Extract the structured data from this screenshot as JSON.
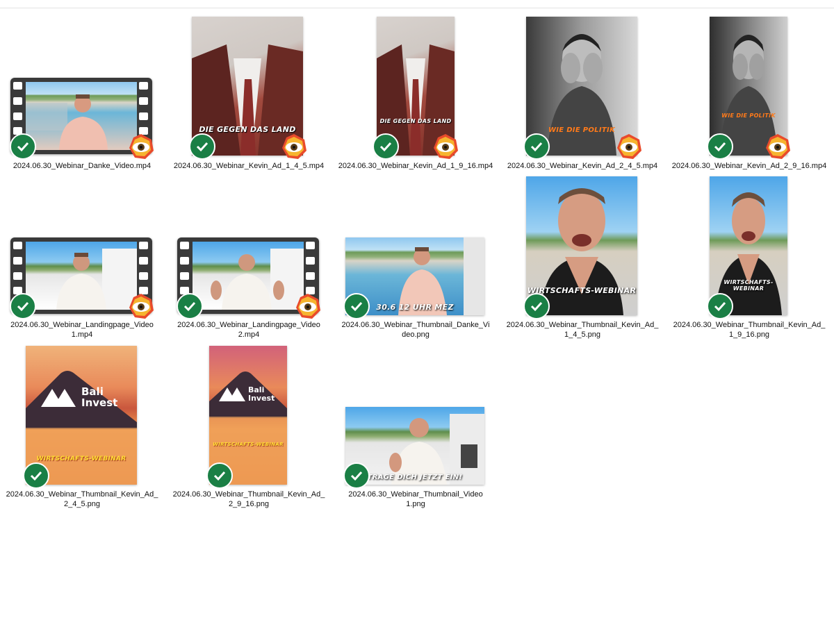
{
  "files": [
    {
      "name": "2024.06.30_Webinar_Danke_Video.mp4",
      "kind": "video",
      "overlay_text": ""
    },
    {
      "name": "2024.06.30_Webinar_Kevin_Ad_1_4_5.mp4",
      "kind": "video",
      "overlay_text": "DIE GEGEN DAS LAND"
    },
    {
      "name": "2024.06.30_Webinar_Kevin_Ad_1_9_16.mp4",
      "kind": "video",
      "overlay_text": "DIE GEGEN DAS LAND"
    },
    {
      "name": "2024.06.30_Webinar_Kevin_Ad_2_4_5.mp4",
      "kind": "video",
      "overlay_text": "WIE DIE POLITIK"
    },
    {
      "name": "2024.06.30_Webinar_Kevin_Ad_2_9_16.mp4",
      "kind": "video",
      "overlay_text": "WIE DIE POLITIK"
    },
    {
      "name": "2024.06.30_Webinar_Landingpage_Video\n1.mp4",
      "kind": "video",
      "overlay_text": ""
    },
    {
      "name": "2024.06.30_Webinar_Landingpage_Video\n2.mp4",
      "kind": "video",
      "overlay_text": ""
    },
    {
      "name": "2024.06.30_Webinar_Thumbnail_Danke_Vi\ndeo.png",
      "kind": "image",
      "overlay_text": "30.6 12 UHR MEZ"
    },
    {
      "name": "2024.06.30_Webinar_Thumbnail_Kevin_Ad_\n1_4_5.png",
      "kind": "image",
      "overlay_text": "WIRTSCHAFTS-WEBINAR"
    },
    {
      "name": "2024.06.30_Webinar_Thumbnail_Kevin_Ad_\n1_9_16.png",
      "kind": "image",
      "overlay_text": "WIRTSCHAFTS-WEBINAR"
    },
    {
      "name": "2024.06.30_Webinar_Thumbnail_Kevin_Ad_\n2_4_5.png",
      "kind": "image",
      "overlay_text": "WIRTSCHAFTS-WEBINAR",
      "brand_line1": "Bali",
      "brand_line2": "Invest"
    },
    {
      "name": "2024.06.30_Webinar_Thumbnail_Kevin_Ad_\n2_9_16.png",
      "kind": "image",
      "overlay_text": "WIRTSCHAFTS-WEBINAR",
      "brand_line1": "Bali",
      "brand_line2": "Invest"
    },
    {
      "name": "2024.06.30_Webinar_Thumbnail_Video\n1.png",
      "kind": "image",
      "overlay_text": "TRAGE DICH JETZT EIN!"
    }
  ],
  "icons": {
    "sync_status": "green-check-icon",
    "preview_overlay": "eye-icon",
    "video_frame": "film-strip-icon"
  },
  "colors": {
    "sync_green": "#1a7f45",
    "caption_orange": "#ff7a1a",
    "caption_white": "#ffffff"
  }
}
